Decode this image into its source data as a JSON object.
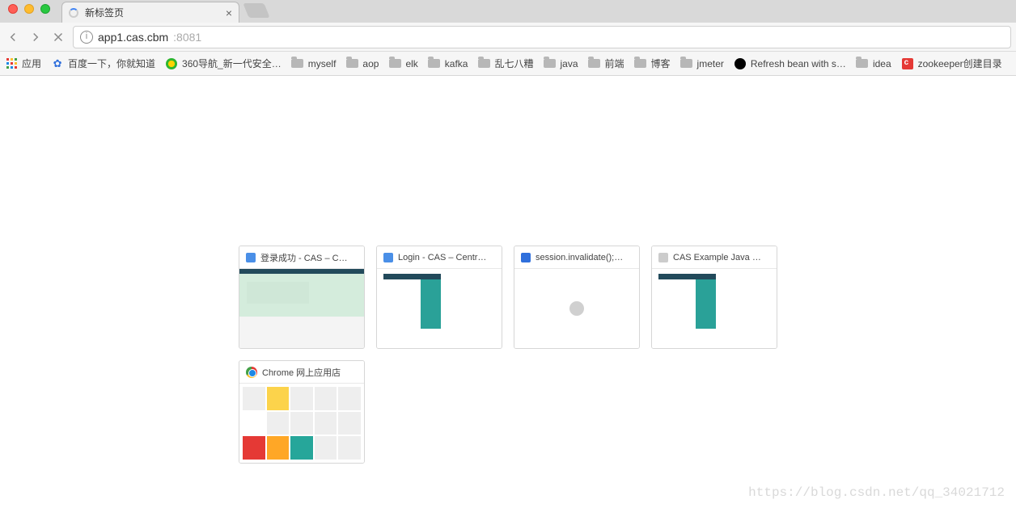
{
  "tab": {
    "title": "新标签页"
  },
  "addressbar": {
    "host": "app1.cas.cbm",
    "port": ":8081"
  },
  "bookmarks": [
    {
      "icon": "apps",
      "label": "应用"
    },
    {
      "icon": "baidu",
      "label": "百度一下，你就知道"
    },
    {
      "icon": "360",
      "label": "360导航_新一代安全…"
    },
    {
      "icon": "folder",
      "label": "myself"
    },
    {
      "icon": "folder",
      "label": "aop"
    },
    {
      "icon": "folder",
      "label": "elk"
    },
    {
      "icon": "folder",
      "label": "kafka"
    },
    {
      "icon": "folder",
      "label": "乱七八糟"
    },
    {
      "icon": "folder",
      "label": "java"
    },
    {
      "icon": "folder",
      "label": "前端"
    },
    {
      "icon": "folder",
      "label": "博客"
    },
    {
      "icon": "folder",
      "label": "jmeter"
    },
    {
      "icon": "github",
      "label": "Refresh bean with s…"
    },
    {
      "icon": "folder",
      "label": "idea"
    },
    {
      "icon": "red",
      "label": "zookeeper创建目录"
    }
  ],
  "tiles": [
    {
      "favicon": "blue",
      "title": "登录成功 - CAS – C…"
    },
    {
      "favicon": "blue",
      "title": "Login - CAS – Centr…"
    },
    {
      "favicon": "paw",
      "title": "session.invalidate();…"
    },
    {
      "favicon": "doc",
      "title": "CAS Example Java …"
    },
    {
      "favicon": "chrome",
      "title": "Chrome 网上应用店"
    }
  ],
  "watermark": "https://blog.csdn.net/qq_34021712"
}
